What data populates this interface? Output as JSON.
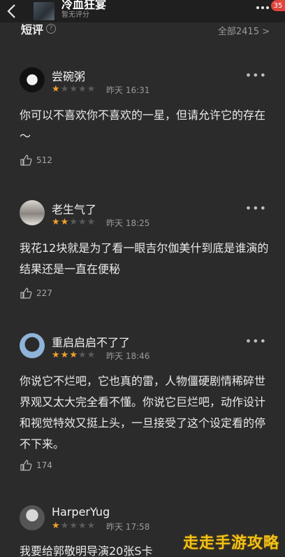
{
  "header": {
    "title": "冷血狂宴",
    "subtitle": "暂无评分",
    "badge": "35"
  },
  "section": {
    "title": "短评",
    "help": "?",
    "all_label": "全部2415 >"
  },
  "comments": [
    {
      "user": "尝碗粥",
      "rating": 1,
      "time": "昨天 16:31",
      "text": "你可以不喜欢你不喜欢的一星，但请允许它的存在～",
      "likes": "512"
    },
    {
      "user": "老生气了",
      "rating": 2,
      "time": "昨天 18:25",
      "text": "我花12块就是为了看一眼吉尔伽美什到底是谁演的 结果还是一直在便秘",
      "likes": "227"
    },
    {
      "user": "重启启启不了了",
      "rating": 3,
      "time": "昨天 18:46",
      "text": "你说它不烂吧，它也真的雷，人物僵硬剧情稀碎世界观又太大完全看不懂。你说它巨烂吧，动作设计和视觉特效又挺上头，一旦接受了这个设定看的停不下来。",
      "likes": "174"
    },
    {
      "user": "HarperYug",
      "rating": 1,
      "time": "昨天 17:58",
      "text": "我要给郭敬明导演20张S卡",
      "likes": ""
    }
  ],
  "watermark": "走走手游攻略",
  "colors": {
    "background": "#2b2b2b",
    "star_on": "#f0a12b",
    "star_off": "#5a5a5a",
    "badge": "#e0443c",
    "watermark": "#f3c21a"
  }
}
